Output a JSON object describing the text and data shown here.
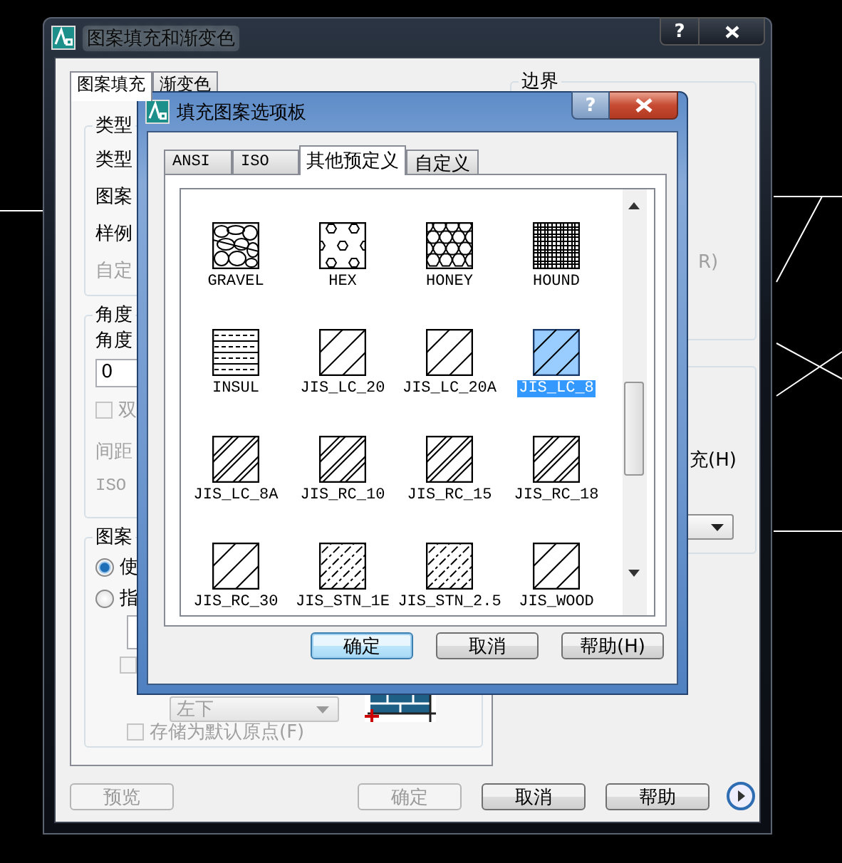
{
  "main_dialog": {
    "title": "图案填充和渐变色",
    "help": "?",
    "tabs": [
      {
        "label": "图案填充",
        "selected": true
      },
      {
        "label": "渐变色",
        "selected": false
      }
    ],
    "type_group": {
      "title": "类型",
      "rows": [
        {
          "label": "类型",
          "disabled": false
        },
        {
          "label": "图案",
          "disabled": false
        },
        {
          "label": "样例",
          "disabled": false
        },
        {
          "label": "自定",
          "disabled": true
        }
      ]
    },
    "angle_group": {
      "title": "角度",
      "angle_label": "角度",
      "angle_value": "0",
      "double": {
        "label": "双",
        "checked": false,
        "disabled": true
      },
      "spacing_label": "间距",
      "iso_label": "ISO"
    },
    "origin_group": {
      "title": "图案",
      "options": [
        {
          "label": "使",
          "selected": true
        },
        {
          "label": "指",
          "selected": false
        }
      ],
      "default_checkbox": {
        "checked": false,
        "disabled": true
      },
      "position": {
        "value": "左下",
        "disabled": true
      },
      "store": {
        "label": "存储为默认原点(F)",
        "checked": false,
        "disabled": true
      }
    },
    "boundary_group": {
      "title": "边界",
      "hint": "R)"
    },
    "options_group": {
      "label": "充(H)"
    },
    "buttons": [
      {
        "label": "预览",
        "disabled": true
      },
      {
        "label": "确定",
        "disabled": true
      },
      {
        "label": "取消",
        "disabled": false
      },
      {
        "label": "帮助",
        "disabled": false
      }
    ]
  },
  "palette": {
    "title": "填充图案选项板",
    "help": "?",
    "tabs": [
      {
        "label": "ANSI",
        "selected": false
      },
      {
        "label": "ISO",
        "selected": false
      },
      {
        "label": "其他预定义",
        "selected": true
      },
      {
        "label": "自定义",
        "selected": false
      }
    ],
    "patterns": [
      {
        "name": "GRAVEL",
        "kind": "gravel",
        "selected": false
      },
      {
        "name": "HEX",
        "kind": "hex",
        "selected": false
      },
      {
        "name": "HONEY",
        "kind": "honey",
        "selected": false
      },
      {
        "name": "HOUND",
        "kind": "hound",
        "selected": false
      },
      {
        "name": "INSUL",
        "kind": "insul",
        "selected": false
      },
      {
        "name": "JIS_LC_20",
        "kind": "hatch",
        "selected": false
      },
      {
        "name": "JIS_LC_20A",
        "kind": "hatch",
        "selected": false
      },
      {
        "name": "JIS_LC_8",
        "kind": "hatch",
        "selected": true
      },
      {
        "name": "JIS_LC_8A",
        "kind": "double",
        "selected": false
      },
      {
        "name": "JIS_RC_10",
        "kind": "double",
        "selected": false
      },
      {
        "name": "JIS_RC_15",
        "kind": "double",
        "selected": false
      },
      {
        "name": "JIS_RC_18",
        "kind": "double",
        "selected": false
      },
      {
        "name": "JIS_RC_30",
        "kind": "hatch",
        "selected": false
      },
      {
        "name": "JIS_STN_1E",
        "kind": "dashed",
        "selected": false
      },
      {
        "name": "JIS_STN_2.5",
        "kind": "dashed",
        "selected": false
      },
      {
        "name": "JIS_WOOD",
        "kind": "hatch",
        "selected": false
      }
    ],
    "buttons": [
      {
        "label": "确定",
        "default": true
      },
      {
        "label": "取消",
        "default": false
      },
      {
        "label": "帮助(H)",
        "default": false
      }
    ]
  }
}
